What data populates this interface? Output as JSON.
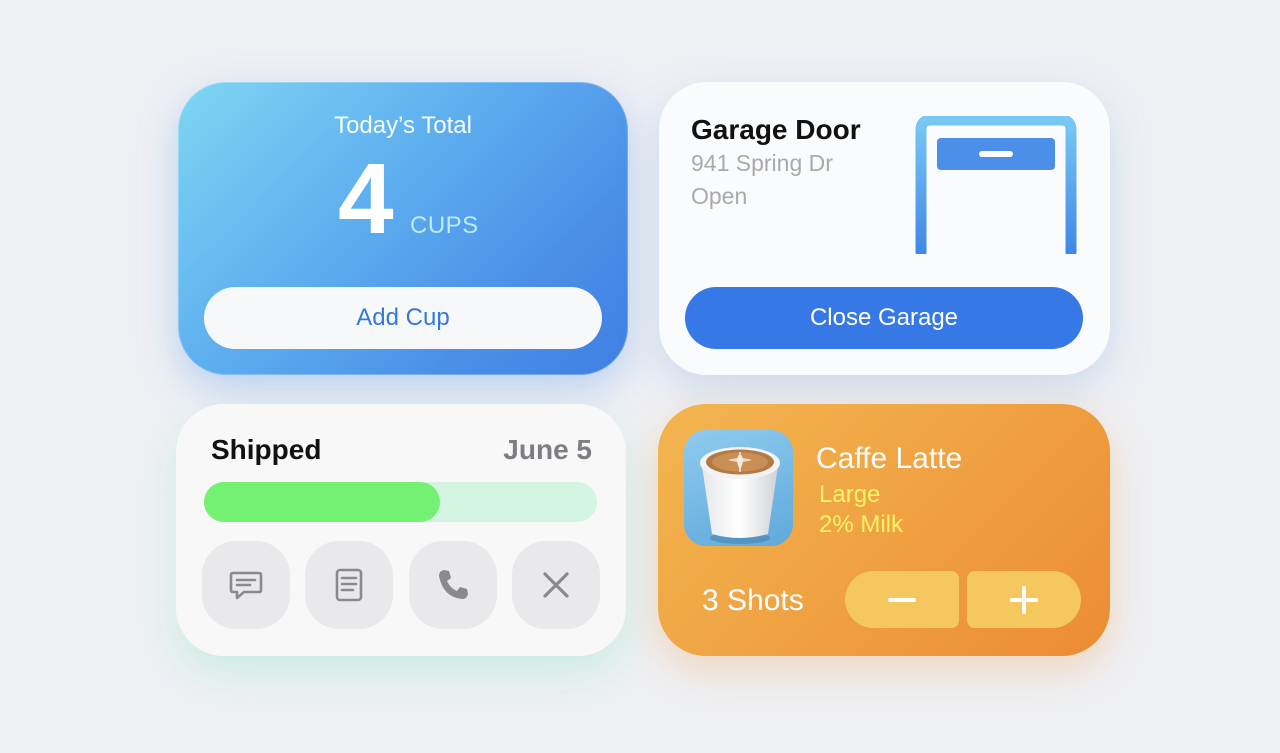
{
  "water": {
    "title": "Today’s Total",
    "count": "4",
    "unit": "CUPS",
    "button_label": "Add Cup"
  },
  "garage": {
    "name": "Garage Door",
    "address": "941 Spring Dr",
    "status": "Open",
    "button_label": "Close Garage",
    "icon": "garage-door-icon"
  },
  "shipping": {
    "label": "Shipped",
    "date": "June 5",
    "progress": 0.6,
    "actions": [
      {
        "name": "message-icon"
      },
      {
        "name": "document-icon"
      },
      {
        "name": "phone-icon"
      },
      {
        "name": "close-icon"
      }
    ]
  },
  "coffee": {
    "drink": "Caffe Latte",
    "size": "Large",
    "milk": "2% Milk",
    "shots": "3 Shots",
    "image": "latte-cup-image"
  },
  "colors": {
    "water_gradient_start": "#7fd6f3",
    "water_gradient_end": "#3f7fe2",
    "garage_button": "#3678e6",
    "progress_fill": "#74f073",
    "progress_track": "#d3f5e1",
    "coffee_gradient_start": "#f3b54f",
    "coffee_gradient_end": "#ec8b33",
    "coffee_accent": "#fff36a"
  }
}
